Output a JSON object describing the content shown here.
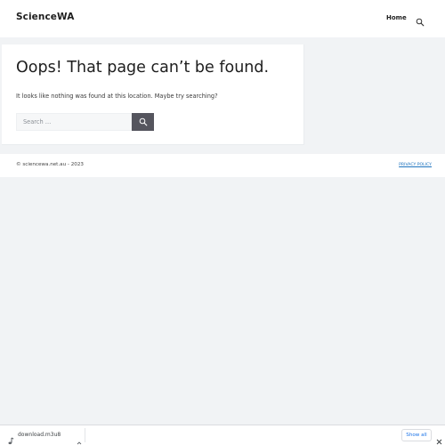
{
  "header": {
    "site_title": "ScienceWA",
    "nav": {
      "home_label": "Home"
    },
    "search_icon": "search-icon"
  },
  "main": {
    "heading": "Oops! That page can’t be found.",
    "message": "It looks like nothing was found at this location. Maybe try searching?",
    "search": {
      "placeholder": "Search …",
      "value": "",
      "submit_icon": "search-icon"
    }
  },
  "footer": {
    "copyright": "© sciencewa.net.au - 2023",
    "privacy_label": "PRIVACY POLICY"
  },
  "download_bar": {
    "file_icon": "music-file-icon",
    "filename": "download.m3u8",
    "show_all_label": "Show all",
    "close_icon": "close-icon"
  },
  "colors": {
    "page_background": "#f1f3f5",
    "search_button": "#55555e",
    "link": "#1e73be",
    "download_accent": "#1a73e8"
  }
}
